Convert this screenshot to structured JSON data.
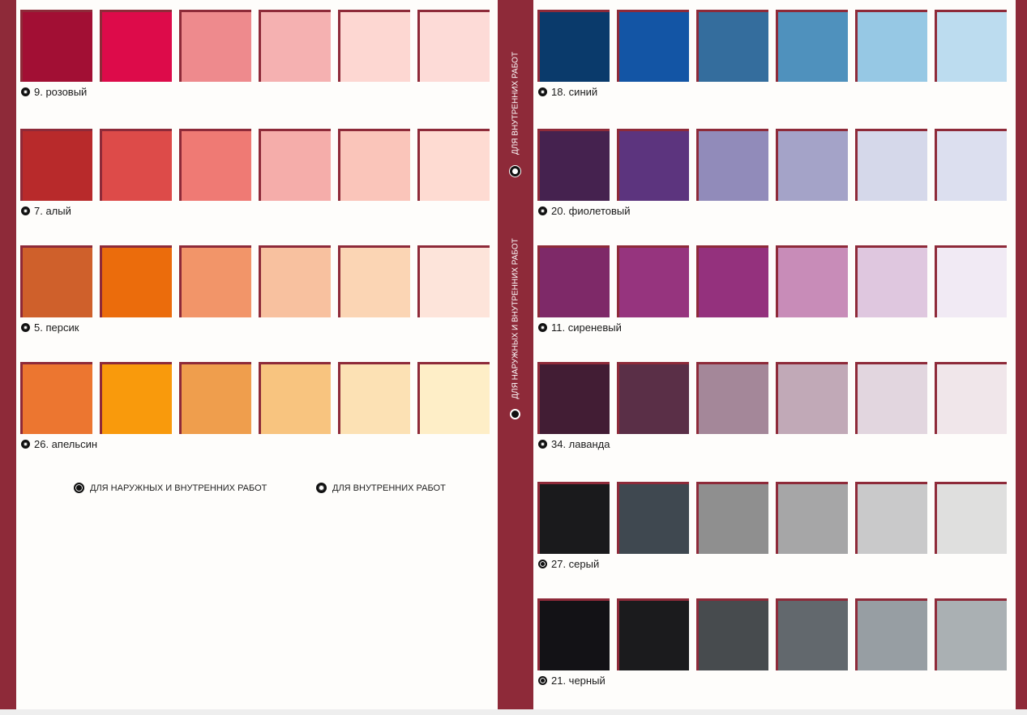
{
  "left_palettes": [
    {
      "label": "9. розовый",
      "marker": "open",
      "colors": [
        "#a20f34",
        "#dd0b4a",
        "#ee8a8d",
        "#f5b1b1",
        "#fdd7d2",
        "#fddbd7"
      ]
    },
    {
      "label": "7. алый",
      "marker": "open",
      "colors": [
        "#b82a2b",
        "#dd4b49",
        "#ef7a74",
        "#f5adaa",
        "#fac5ba",
        "#fedbd2"
      ]
    },
    {
      "label": "5. персик",
      "marker": "open",
      "colors": [
        "#cf602b",
        "#eb6c0c",
        "#f29569",
        "#f8c19f",
        "#fbd5b4",
        "#fde4da"
      ]
    },
    {
      "label": "26. апельсин",
      "marker": "open",
      "colors": [
        "#ec7630",
        "#f99a0c",
        "#ef9e4d",
        "#f8c47f",
        "#fce1b4",
        "#feeec7"
      ]
    }
  ],
  "right_palettes": [
    {
      "label": "18. синий",
      "marker": "open",
      "colors": [
        "#0a3a6b",
        "#1355a5",
        "#346d9d",
        "#4f91bd",
        "#96c8e4",
        "#bcdcef"
      ]
    },
    {
      "label": "20. фиолетовый",
      "marker": "open",
      "colors": [
        "#45224f",
        "#5c347e",
        "#918bba",
        "#a4a3c8",
        "#d5d8ea",
        "#dcdfef"
      ]
    },
    {
      "label": "11. сиреневый",
      "marker": "open",
      "colors": [
        "#7e2968",
        "#96347e",
        "#94317d",
        "#c88cb8",
        "#dfc7df",
        "#f1eaf4"
      ]
    },
    {
      "label": "34. лаванда",
      "marker": "open",
      "colors": [
        "#421d34",
        "#5a2f47",
        "#a48799",
        "#c1a9b7",
        "#e2d6df",
        "#f0e6ea"
      ]
    },
    {
      "label": "27. серый",
      "marker": "filled",
      "colors": [
        "#1a1a1c",
        "#3f4850",
        "#8f8f8f",
        "#a6a6a7",
        "#c9c9ca",
        "#dfdfde"
      ]
    },
    {
      "label": "21. черный",
      "marker": "filled",
      "colors": [
        "#131216",
        "#1b1b1d",
        "#474b4e",
        "#62686d",
        "#979ea3",
        "#aab0b3"
      ]
    }
  ],
  "legend": {
    "exterior_label": "ДЛЯ НАРУЖНЫХ И ВНУТРЕННИХ РАБОТ",
    "interior_label": "ДЛЯ ВНУТРЕННИХ РАБОТ"
  },
  "spine": {
    "interior_label": "ДЛЯ ВНУТРЕННИХ РАБОТ",
    "exterior_label": "ДЛЯ НАРУЖНЫХ И ВНУТРЕННИХ РАБОТ"
  },
  "colors": {
    "brand_band": "#8e2a39",
    "page_background": "#fefdfb"
  }
}
